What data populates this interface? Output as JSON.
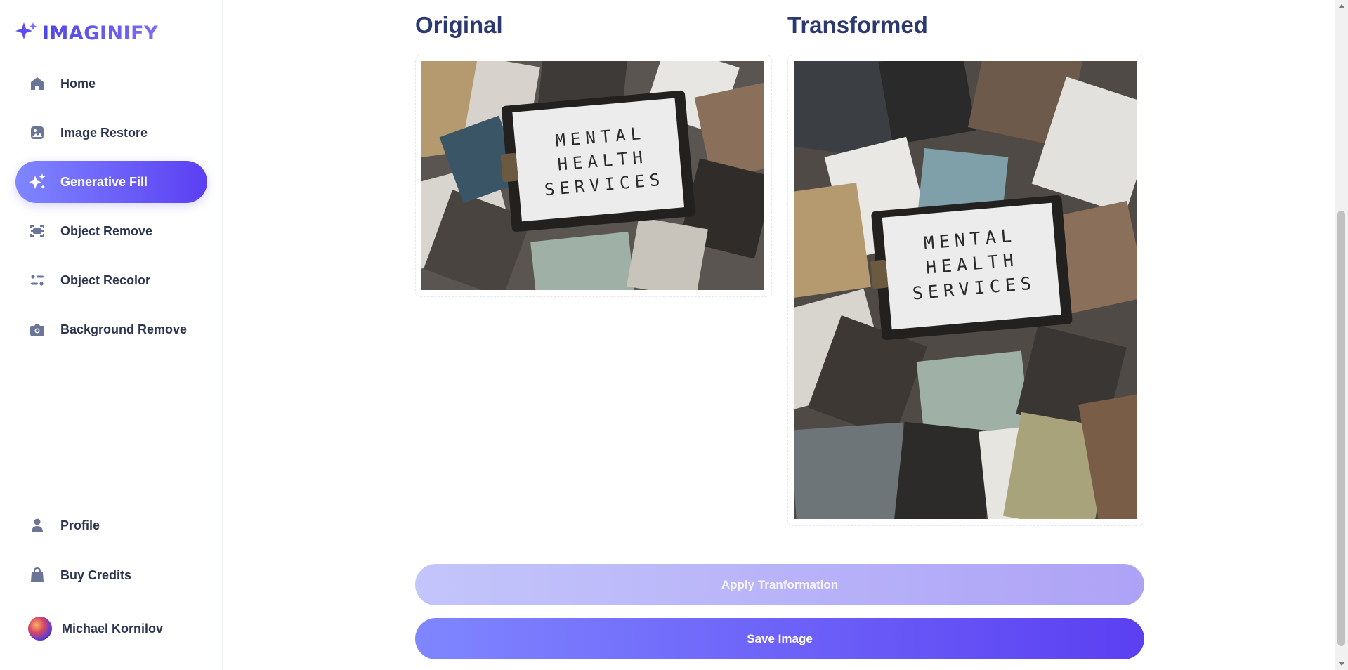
{
  "app": {
    "logo_text": "IMAGINIFY",
    "accent": "#5b3ff2"
  },
  "sidebar": {
    "nav": [
      {
        "label": "Home",
        "icon": "home-icon"
      },
      {
        "label": "Image Restore",
        "icon": "image-icon"
      },
      {
        "label": "Generative Fill",
        "icon": "sparkles-icon",
        "active": true
      },
      {
        "label": "Object Remove",
        "icon": "scan-icon"
      },
      {
        "label": "Object Recolor",
        "icon": "filter-icon"
      },
      {
        "label": "Background Remove",
        "icon": "camera-icon"
      }
    ],
    "bottom": [
      {
        "label": "Profile",
        "icon": "user-icon"
      },
      {
        "label": "Buy Credits",
        "icon": "bag-icon"
      }
    ],
    "user": {
      "name": "Michael Kornilov"
    }
  },
  "main": {
    "original_title": "Original",
    "transformed_title": "Transformed",
    "photo_text": [
      "MENTAL",
      "HEALTH",
      "SERVICES"
    ],
    "apply_label": "Apply Tranformation",
    "save_label": "Save Image"
  }
}
